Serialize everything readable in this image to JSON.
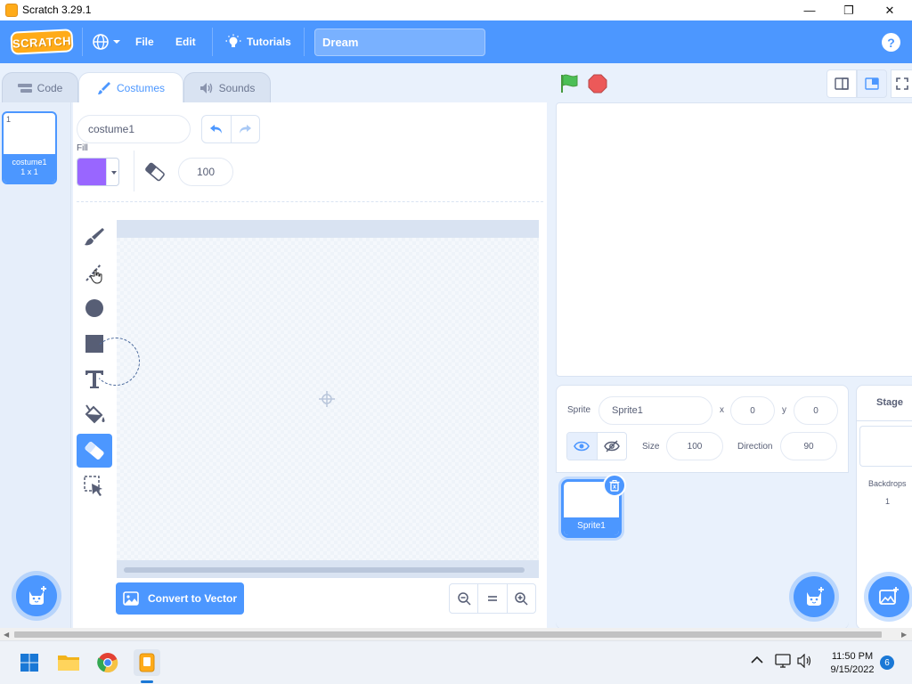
{
  "window": {
    "title": "Scratch 3.29.1",
    "minimize": "—",
    "maximize": "❐",
    "close": "✕"
  },
  "menubar": {
    "logo": "SCRATCH",
    "file": "File",
    "edit": "Edit",
    "tutorials": "Tutorials",
    "project_title": "Dream",
    "help": "?"
  },
  "tabs": [
    {
      "label": "Code",
      "icon": "code-icon",
      "active": false
    },
    {
      "label": "Costumes",
      "icon": "brush-icon",
      "active": true
    },
    {
      "label": "Sounds",
      "icon": "speaker-icon",
      "active": false
    }
  ],
  "costumes": [
    {
      "number": "1",
      "name": "costume1",
      "size": "1 x 1"
    }
  ],
  "paint": {
    "costume_name": "costume1",
    "fill_label": "Fill",
    "fill_color": "#9966ff",
    "eraser_size": "100",
    "convert_label": "Convert to Vector",
    "selected_tool": "eraser"
  },
  "sprite_info": {
    "sprite_label": "Sprite",
    "sprite_name": "Sprite1",
    "x_label": "x",
    "x_value": "0",
    "y_label": "y",
    "y_value": "0",
    "show_label": "Show",
    "size_label": "Size",
    "size_value": "100",
    "direction_label": "Direction",
    "direction_value": "90"
  },
  "sprites": [
    {
      "name": "Sprite1",
      "selected": true
    }
  ],
  "stage_pane": {
    "title": "Stage",
    "backdrops_label": "Backdrops",
    "backdrops_count": "1"
  },
  "taskbar": {
    "time": "11:50 PM",
    "date": "9/15/2022",
    "notifications": "6"
  },
  "colors": {
    "accent": "#4c97ff",
    "menubar": "#4c97ff",
    "green_flag": "#4cbf56",
    "stop": "#ec5959",
    "scratch_orange": "#ffab19"
  }
}
